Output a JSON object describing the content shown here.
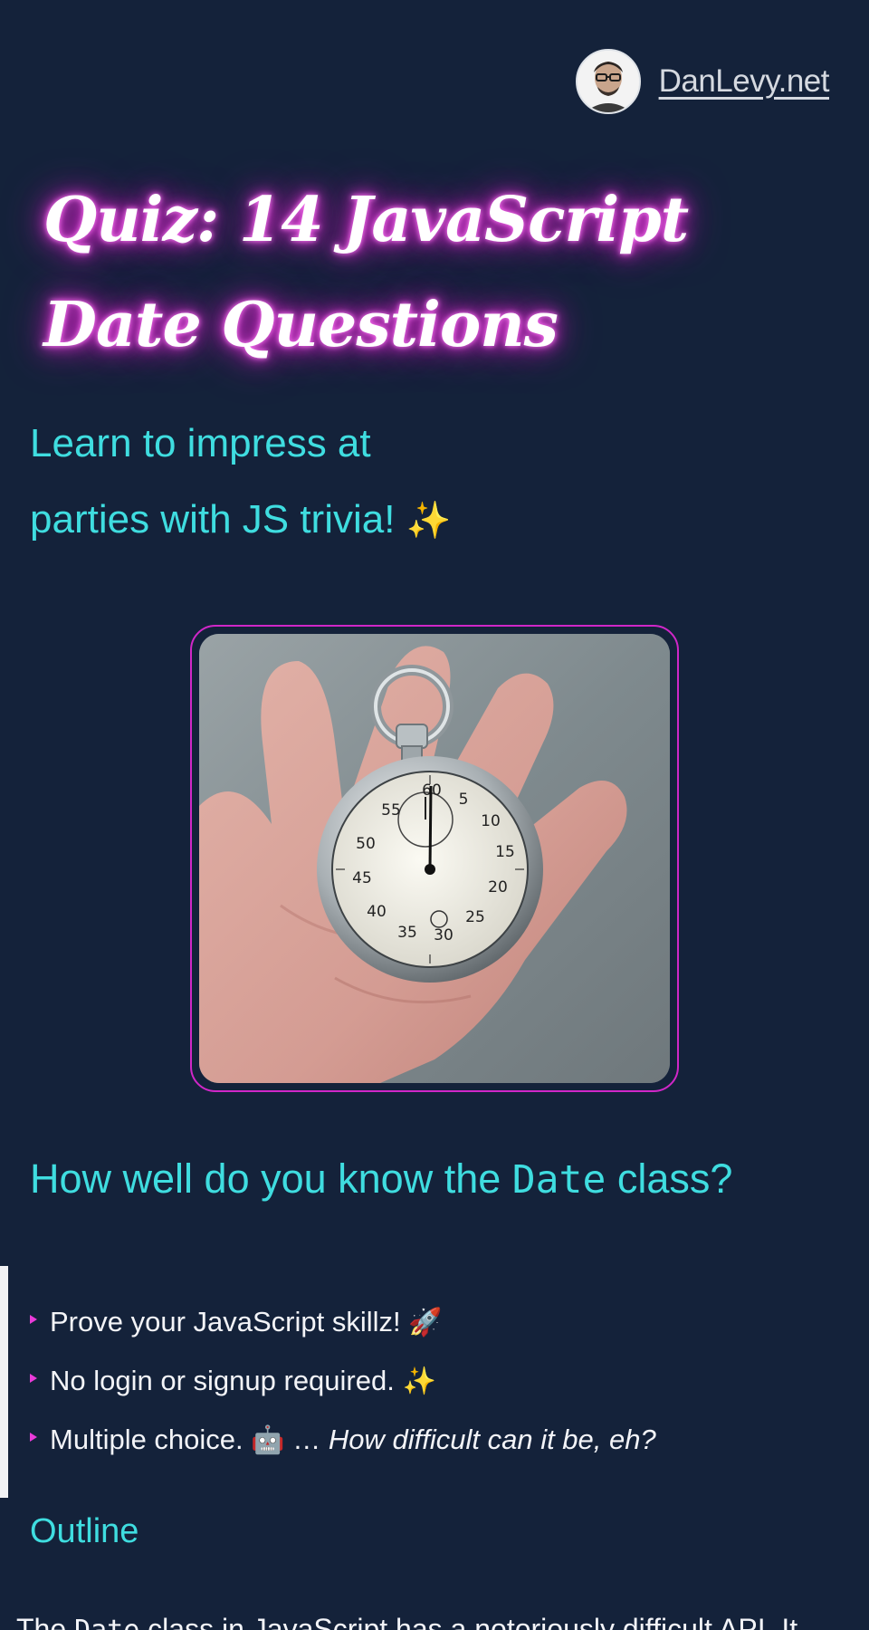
{
  "header": {
    "site_link": "DanLevy.net",
    "avatar_icon": "person-portrait-icon"
  },
  "hero": {
    "title_line1": "Quiz: 14 JavaScript",
    "title_line2": "Date Questions",
    "subtitle_line1": "Learn to impress at",
    "subtitle_line2": "parties with JS trivia!",
    "subtitle_emoji": "✨",
    "image_icon": "stopwatch-in-hand-photo",
    "stopwatch_numbers": [
      "60",
      "5",
      "10",
      "15",
      "20",
      "25",
      "30",
      "35",
      "40",
      "45",
      "50",
      "55"
    ]
  },
  "section": {
    "heading_before": "How well do you know the ",
    "heading_code": "Date",
    "heading_after": " class?"
  },
  "features": {
    "item1_text": "Prove your JavaScript skillz!",
    "item1_emoji": "🚀",
    "item2_text": "No login or signup required.",
    "item2_emoji": "✨",
    "item3_text": "Multiple choice.",
    "item3_emoji": "🤖",
    "item3_ellipsis": " … ",
    "item3_italic": "How difficult can it be, eh?"
  },
  "outline": {
    "label": "Outline"
  },
  "intro": {
    "before_code": "The ",
    "code": "Date",
    "after_code": " class in JavaScript has a notoriously difficult API. It"
  },
  "colors": {
    "background": "#14223a",
    "accent_cyan": "#3fdde0",
    "neon_magenta": "#d027c8",
    "text": "#f1f3f7"
  }
}
